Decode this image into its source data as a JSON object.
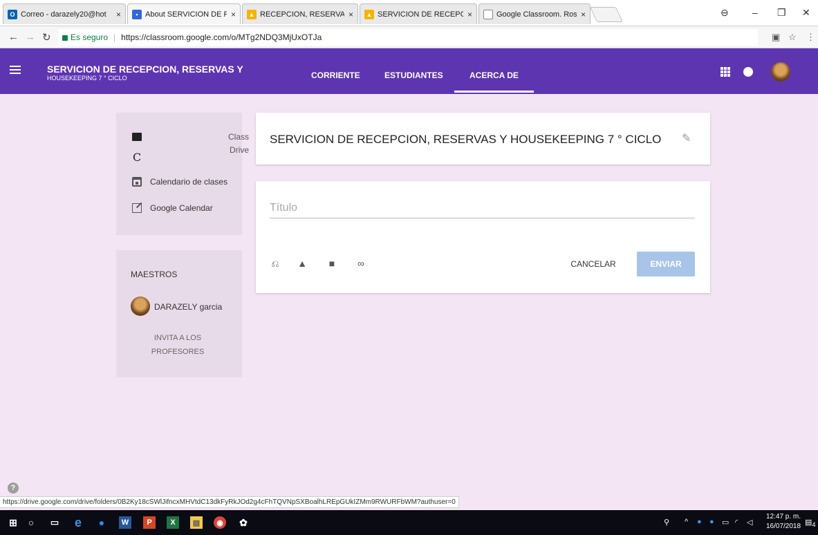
{
  "browser": {
    "tabs": [
      {
        "label": "Correo - darazely20@hot",
        "icon": "outlook-icon",
        "color": "#0a64ad"
      },
      {
        "label": "About SERVICION DE RE",
        "icon": "classroom-icon",
        "color": "#3367d6"
      },
      {
        "label": "RECEPCION, RESERVAS Y",
        "icon": "drive-icon",
        "color": "#f4b400"
      },
      {
        "label": "SERVICION DE RECEPCIO",
        "icon": "drive-icon",
        "color": "#f4b400"
      },
      {
        "label": "Google Classroom. Rosa",
        "icon": "document-icon",
        "color": "#888888"
      }
    ],
    "close_glyph": "×",
    "address": {
      "secure_label": "Es seguro",
      "url": "https://classroom.google.com/o/MTg2NDQ3MjUxOTJa"
    },
    "status_url": "https://drive.google.com/drive/folders/0B2Ky18cSWlJifncxMHVtdC13dkFyRkJOd2g4cFhTQVNpSXBoalhLREpGUkIZMm9RWURFbWM?authuser=0"
  },
  "header": {
    "title_line1": "SERVICION DE RECEPCION, RESERVAS Y",
    "title_line2": "HOUSEKEEPING 7 ° CICLO",
    "tabs": [
      {
        "label": "CORRIENTE"
      },
      {
        "label": "ESTUDIANTES"
      },
      {
        "label": "ACERCA DE",
        "active": true
      }
    ],
    "accent": "#5e35b1"
  },
  "sidebar": {
    "drive_letter": "C",
    "drive_label_line1": "Class",
    "drive_label_line2": "Drive",
    "links": [
      {
        "label": "Calendario de clases",
        "icon": "calendar-icon"
      },
      {
        "label": "Google Calendar",
        "icon": "external-link-icon"
      }
    ],
    "teachers_heading": "MAESTROS",
    "teacher_name": "DARAZELY garcia",
    "invite_label": "INVITA A LOS PROFESORES"
  },
  "main": {
    "class_title": "SERVICION DE RECEPCION, RESERVAS Y HOUSEKEEPING 7 ° CICLO",
    "post": {
      "title_placeholder": "Título",
      "cancel_label": "CANCELAR",
      "send_label": "ENVIAR",
      "attach_icons": [
        "paperclip-icon",
        "drive-icon",
        "youtube-icon",
        "link-icon"
      ]
    }
  },
  "taskbar": {
    "clock_time": "12:47 p. m.",
    "clock_date": "16/07/2018",
    "notification_count": "4"
  }
}
